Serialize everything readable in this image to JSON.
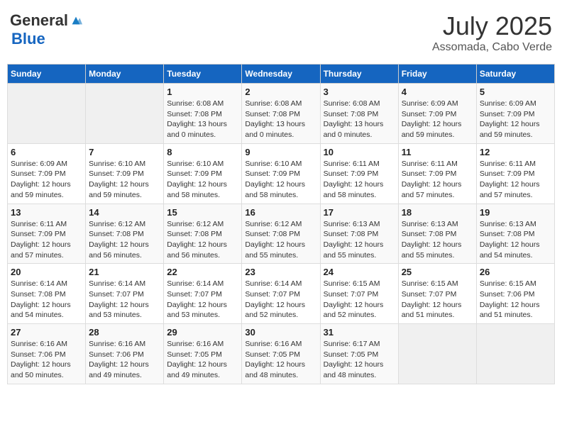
{
  "header": {
    "logo_general": "General",
    "logo_blue": "Blue",
    "month_title": "July 2025",
    "subtitle": "Assomada, Cabo Verde"
  },
  "days_of_week": [
    "Sunday",
    "Monday",
    "Tuesday",
    "Wednesday",
    "Thursday",
    "Friday",
    "Saturday"
  ],
  "weeks": [
    [
      {
        "day": "",
        "info": ""
      },
      {
        "day": "",
        "info": ""
      },
      {
        "day": "1",
        "info": "Sunrise: 6:08 AM\nSunset: 7:08 PM\nDaylight: 13 hours and 0 minutes."
      },
      {
        "day": "2",
        "info": "Sunrise: 6:08 AM\nSunset: 7:08 PM\nDaylight: 13 hours and 0 minutes."
      },
      {
        "day": "3",
        "info": "Sunrise: 6:08 AM\nSunset: 7:08 PM\nDaylight: 13 hours and 0 minutes."
      },
      {
        "day": "4",
        "info": "Sunrise: 6:09 AM\nSunset: 7:09 PM\nDaylight: 12 hours and 59 minutes."
      },
      {
        "day": "5",
        "info": "Sunrise: 6:09 AM\nSunset: 7:09 PM\nDaylight: 12 hours and 59 minutes."
      }
    ],
    [
      {
        "day": "6",
        "info": "Sunrise: 6:09 AM\nSunset: 7:09 PM\nDaylight: 12 hours and 59 minutes."
      },
      {
        "day": "7",
        "info": "Sunrise: 6:10 AM\nSunset: 7:09 PM\nDaylight: 12 hours and 59 minutes."
      },
      {
        "day": "8",
        "info": "Sunrise: 6:10 AM\nSunset: 7:09 PM\nDaylight: 12 hours and 58 minutes."
      },
      {
        "day": "9",
        "info": "Sunrise: 6:10 AM\nSunset: 7:09 PM\nDaylight: 12 hours and 58 minutes."
      },
      {
        "day": "10",
        "info": "Sunrise: 6:11 AM\nSunset: 7:09 PM\nDaylight: 12 hours and 58 minutes."
      },
      {
        "day": "11",
        "info": "Sunrise: 6:11 AM\nSunset: 7:09 PM\nDaylight: 12 hours and 57 minutes."
      },
      {
        "day": "12",
        "info": "Sunrise: 6:11 AM\nSunset: 7:09 PM\nDaylight: 12 hours and 57 minutes."
      }
    ],
    [
      {
        "day": "13",
        "info": "Sunrise: 6:11 AM\nSunset: 7:09 PM\nDaylight: 12 hours and 57 minutes."
      },
      {
        "day": "14",
        "info": "Sunrise: 6:12 AM\nSunset: 7:08 PM\nDaylight: 12 hours and 56 minutes."
      },
      {
        "day": "15",
        "info": "Sunrise: 6:12 AM\nSunset: 7:08 PM\nDaylight: 12 hours and 56 minutes."
      },
      {
        "day": "16",
        "info": "Sunrise: 6:12 AM\nSunset: 7:08 PM\nDaylight: 12 hours and 55 minutes."
      },
      {
        "day": "17",
        "info": "Sunrise: 6:13 AM\nSunset: 7:08 PM\nDaylight: 12 hours and 55 minutes."
      },
      {
        "day": "18",
        "info": "Sunrise: 6:13 AM\nSunset: 7:08 PM\nDaylight: 12 hours and 55 minutes."
      },
      {
        "day": "19",
        "info": "Sunrise: 6:13 AM\nSunset: 7:08 PM\nDaylight: 12 hours and 54 minutes."
      }
    ],
    [
      {
        "day": "20",
        "info": "Sunrise: 6:14 AM\nSunset: 7:08 PM\nDaylight: 12 hours and 54 minutes."
      },
      {
        "day": "21",
        "info": "Sunrise: 6:14 AM\nSunset: 7:07 PM\nDaylight: 12 hours and 53 minutes."
      },
      {
        "day": "22",
        "info": "Sunrise: 6:14 AM\nSunset: 7:07 PM\nDaylight: 12 hours and 53 minutes."
      },
      {
        "day": "23",
        "info": "Sunrise: 6:14 AM\nSunset: 7:07 PM\nDaylight: 12 hours and 52 minutes."
      },
      {
        "day": "24",
        "info": "Sunrise: 6:15 AM\nSunset: 7:07 PM\nDaylight: 12 hours and 52 minutes."
      },
      {
        "day": "25",
        "info": "Sunrise: 6:15 AM\nSunset: 7:07 PM\nDaylight: 12 hours and 51 minutes."
      },
      {
        "day": "26",
        "info": "Sunrise: 6:15 AM\nSunset: 7:06 PM\nDaylight: 12 hours and 51 minutes."
      }
    ],
    [
      {
        "day": "27",
        "info": "Sunrise: 6:16 AM\nSunset: 7:06 PM\nDaylight: 12 hours and 50 minutes."
      },
      {
        "day": "28",
        "info": "Sunrise: 6:16 AM\nSunset: 7:06 PM\nDaylight: 12 hours and 49 minutes."
      },
      {
        "day": "29",
        "info": "Sunrise: 6:16 AM\nSunset: 7:05 PM\nDaylight: 12 hours and 49 minutes."
      },
      {
        "day": "30",
        "info": "Sunrise: 6:16 AM\nSunset: 7:05 PM\nDaylight: 12 hours and 48 minutes."
      },
      {
        "day": "31",
        "info": "Sunrise: 6:17 AM\nSunset: 7:05 PM\nDaylight: 12 hours and 48 minutes."
      },
      {
        "day": "",
        "info": ""
      },
      {
        "day": "",
        "info": ""
      }
    ]
  ]
}
